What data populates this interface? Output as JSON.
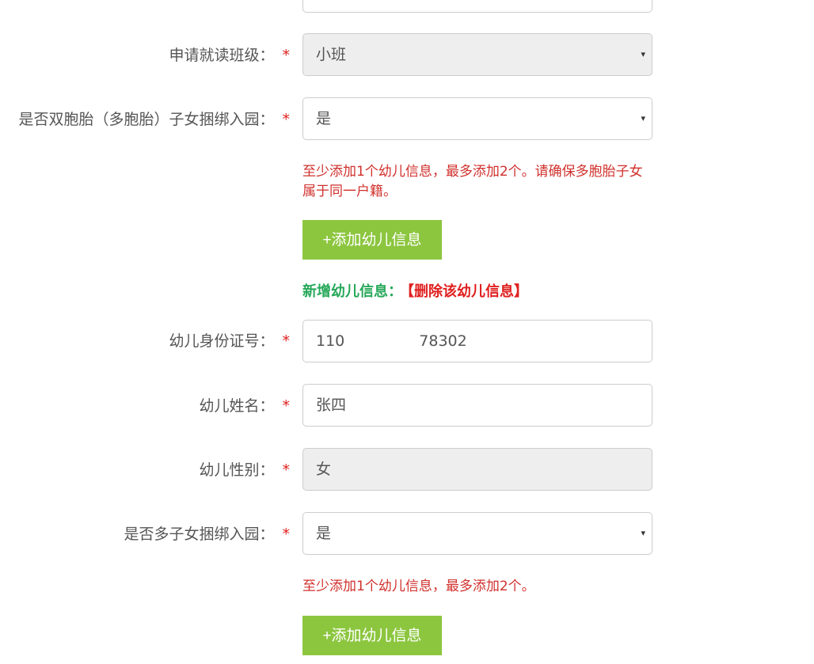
{
  "top_field": {
    "value": ""
  },
  "class_row": {
    "label": "申请就读班级：",
    "required_mark": "*",
    "value": "小班",
    "caret": "▾"
  },
  "twins_row": {
    "label": "是否双胞胎（多胞胎）子女捆绑入园：",
    "required_mark": "*",
    "value": "是",
    "caret": "▾"
  },
  "twins_hint": "至少添加1个幼儿信息，最多添加2个。请确保多胞胎子女属于同一户籍。",
  "add_button_1": "+添加幼儿信息",
  "new_child": {
    "title": "新增幼儿信息：",
    "delete_link": "【删除该幼儿信息】"
  },
  "id_row": {
    "label": "幼儿身份证号：",
    "required_mark": "*",
    "value_prefix": "110",
    "value_suffix": "78302"
  },
  "name_row": {
    "label": "幼儿姓名：",
    "required_mark": "*",
    "value": "张四"
  },
  "gender_row": {
    "label": "幼儿性别：",
    "required_mark": "*",
    "value": "女"
  },
  "multi_row": {
    "label": "是否多子女捆绑入园：",
    "required_mark": "*",
    "value": "是",
    "caret": "▾"
  },
  "multi_hint": "至少添加1个幼儿信息，最多添加2个。",
  "add_button_2": "+添加幼儿信息",
  "colors": {
    "button_green": "#8cc63f",
    "title_green": "#27a85a",
    "error_red": "#d0312d",
    "required_red": "#e02020",
    "disabled_gray": "#eeeeee"
  }
}
